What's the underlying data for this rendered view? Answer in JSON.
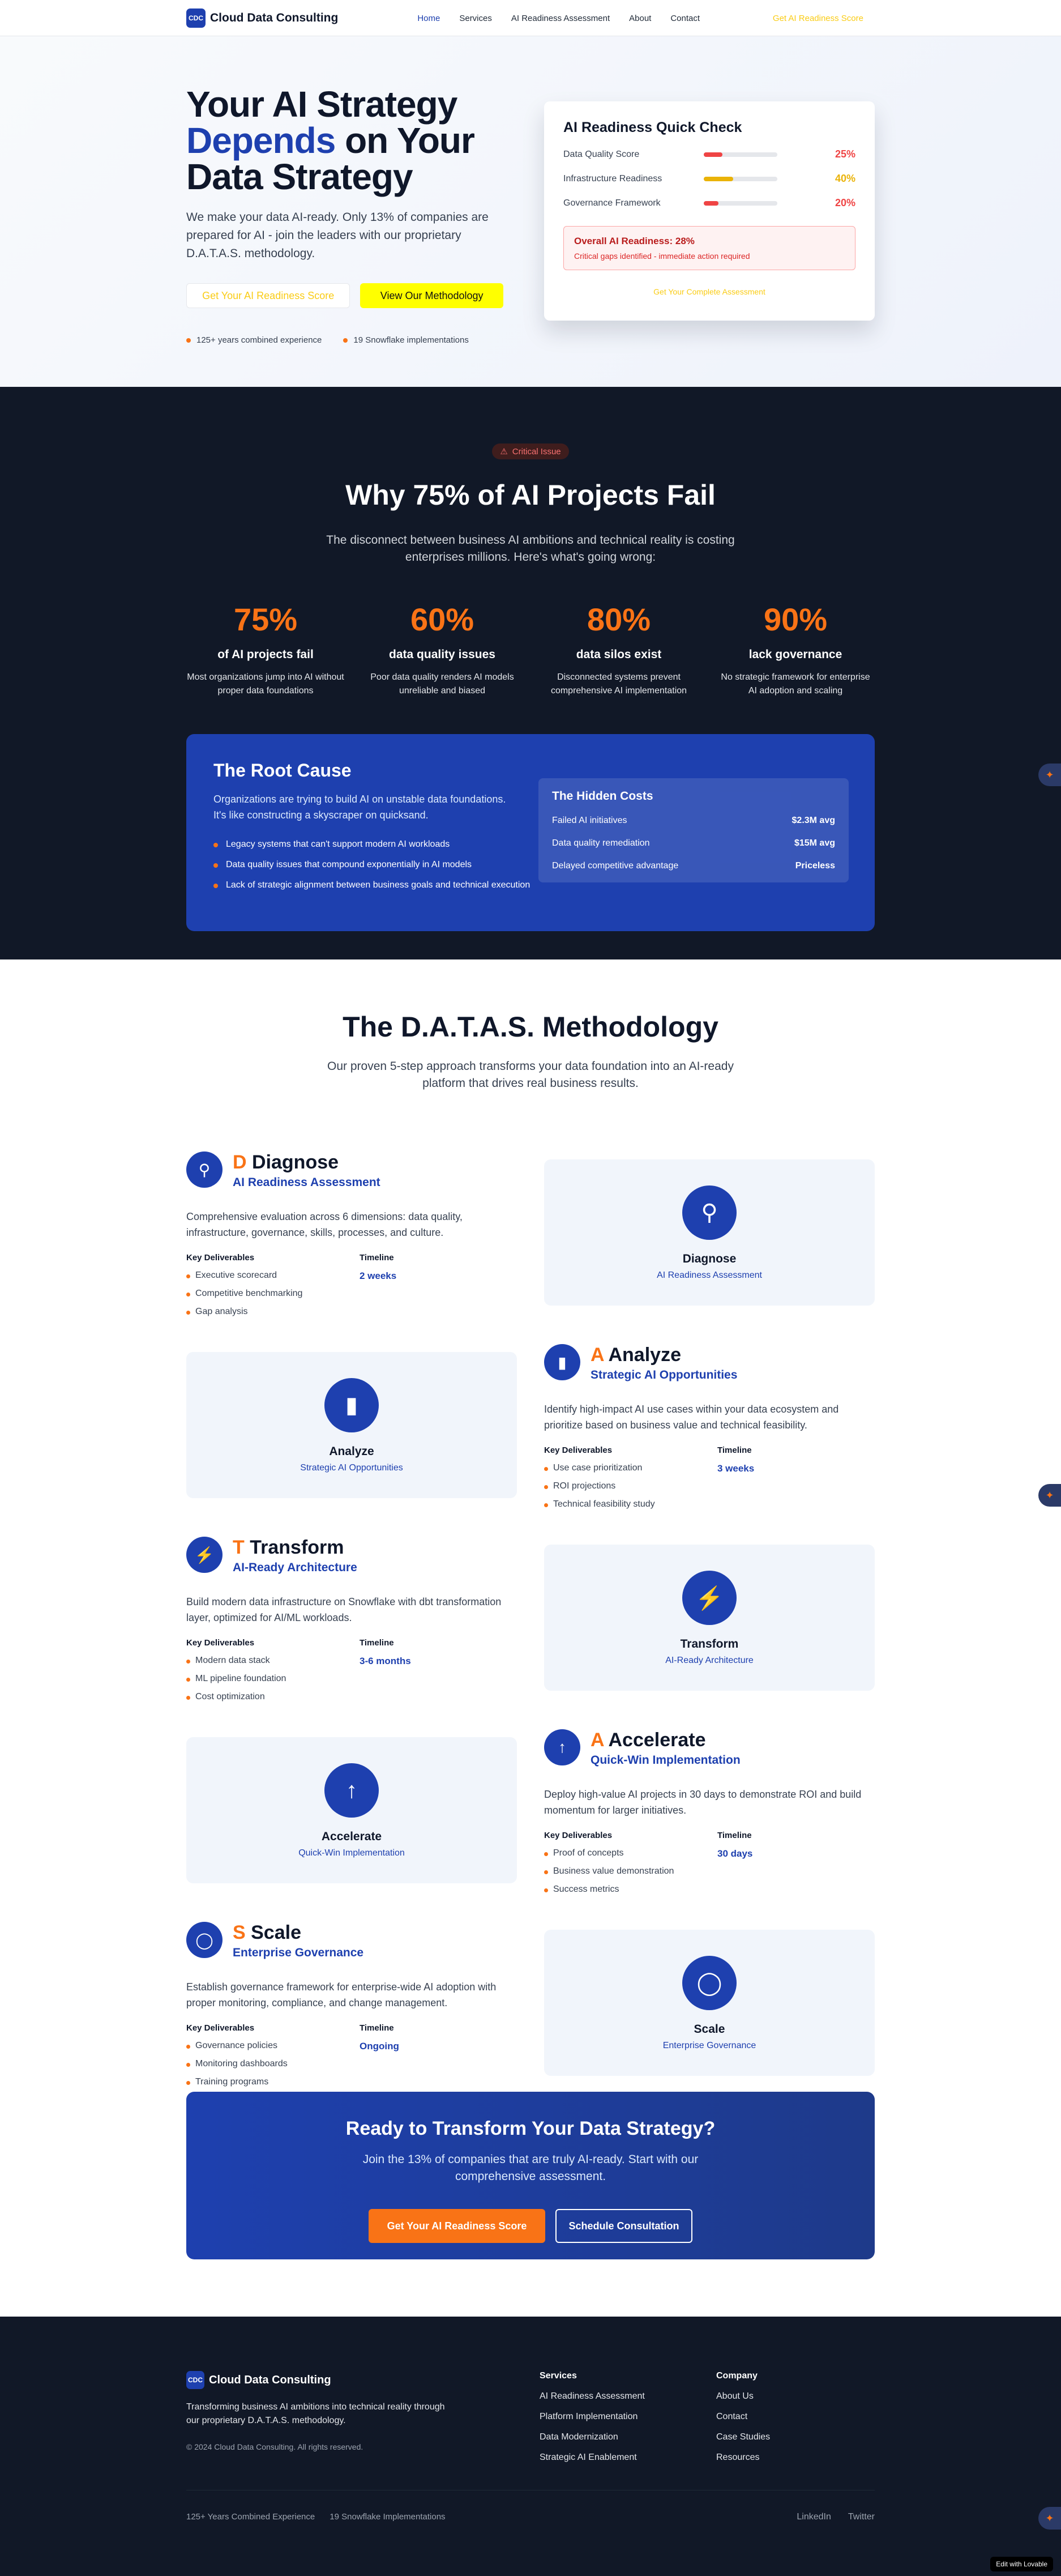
{
  "nav": {
    "brand": "Cloud Data Consulting",
    "logo_text": "CDC",
    "items": [
      "Home",
      "Services",
      "AI Readiness Assessment",
      "About",
      "Contact"
    ],
    "cta": "Get AI Readiness Score"
  },
  "hero": {
    "title_1": "Your AI Strategy",
    "title_blue": "Depends",
    "title_2": " on Your",
    "title_3": "Data Strategy",
    "description": "We make your data AI-ready. Only 13% of companies are prepared for AI - join the leaders with our proprietary D.A.T.A.S. methodology.",
    "btn_primary": "Get Your AI Readiness Score",
    "btn_secondary": "View Our Methodology",
    "stats": [
      "125+ years combined experience",
      "19 Snowflake implementations"
    ],
    "card": {
      "title": "AI Readiness Quick Check",
      "metrics": [
        {
          "label": "Data Quality Score",
          "value": "25%",
          "fill": 0.25,
          "color": "#ef4444"
        },
        {
          "label": "Infrastructure Readiness",
          "value": "40%",
          "fill": 0.4,
          "color": "#eab308"
        },
        {
          "label": "Governance Framework",
          "value": "20%",
          "fill": 0.2,
          "color": "#ef4444"
        }
      ],
      "alert_title": "Overall AI Readiness: 28%",
      "alert_text": "Critical gaps identified - immediate action required",
      "link": "Get Your Complete Assessment"
    }
  },
  "why": {
    "pill": "Critical Issue",
    "title": "Why 75% of AI Projects Fail",
    "subtitle": "The disconnect between business AI ambitions and technical reality is costing enterprises millions. Here's what's going wrong:",
    "stats": [
      {
        "big": "75%",
        "title": "of AI projects fail",
        "desc": "Most organizations jump into AI without proper data foundations"
      },
      {
        "big": "60%",
        "title": "data quality issues",
        "desc": "Poor data quality renders AI models unreliable and biased"
      },
      {
        "big": "80%",
        "title": "data silos exist",
        "desc": "Disconnected systems prevent comprehensive AI implementation"
      },
      {
        "big": "90%",
        "title": "lack governance",
        "desc": "No strategic framework for enterprise AI adoption and scaling"
      }
    ],
    "root": {
      "title": "The Root Cause",
      "text": "Organizations are trying to build AI on unstable data foundations. It's like constructing a skyscraper on quicksand.",
      "items": [
        "Legacy systems that can't support modern AI workloads",
        "Data quality issues that compound exponentially in AI models",
        "Lack of strategic alignment between business goals and technical execution"
      ],
      "hidden_title": "The Hidden Costs",
      "costs": [
        {
          "label": "Failed AI initiatives",
          "value": "$2.3M avg"
        },
        {
          "label": "Data quality remediation",
          "value": "$15M avg"
        },
        {
          "label": "Delayed competitive advantage",
          "value": "Priceless"
        }
      ]
    }
  },
  "method": {
    "title": "The D.A.T.A.S. Methodology",
    "subtitle": "Our proven 5-step approach transforms your data foundation into an AI-ready platform that drives real business results.",
    "deliverables_label": "Key Deliverables",
    "timeline_label": "Timeline",
    "steps": [
      {
        "letter": "D",
        "name": " Diagnose",
        "vis_name": "Diagnose",
        "sub": "AI Readiness Assessment",
        "icon": "search-icon",
        "desc": "Comprehensive evaluation across 6 dimensions: data quality, infrastructure, governance, skills, processes, and culture.",
        "items": [
          "Executive scorecard",
          "Competitive benchmarking",
          "Gap analysis"
        ],
        "timeline": "2 weeks"
      },
      {
        "letter": "A",
        "name": " Analyze",
        "vis_name": "Analyze",
        "sub": "Strategic AI Opportunities",
        "icon": "bar-chart-icon",
        "desc": "Identify high-impact AI use cases within your data ecosystem and prioritize based on business value and technical feasibility.",
        "items": [
          "Use case prioritization",
          "ROI projections",
          "Technical feasibility study"
        ],
        "timeline": "3 weeks"
      },
      {
        "letter": "T",
        "name": " Transform",
        "vis_name": "Transform",
        "sub": "AI-Ready Architecture",
        "icon": "lightning-icon",
        "desc": "Build modern data infrastructure on Snowflake with dbt transformation layer, optimized for AI/ML workloads.",
        "items": [
          "Modern data stack",
          "ML pipeline foundation",
          "Cost optimization"
        ],
        "timeline": "3-6 months"
      },
      {
        "letter": "A",
        "name": " Accelerate",
        "vis_name": "Accelerate",
        "sub": "Quick-Win Implementation",
        "icon": "arrow-up-icon",
        "desc": "Deploy high-value AI projects in 30 days to demonstrate ROI and build momentum for larger initiatives.",
        "items": [
          "Proof of concepts",
          "Business value demonstration",
          "Success metrics"
        ],
        "timeline": "30 days"
      },
      {
        "letter": "S",
        "name": " Scale",
        "vis_name": "Scale",
        "sub": "Enterprise Governance",
        "icon": "shield-icon",
        "desc": "Establish governance framework for enterprise-wide AI adoption with proper monitoring, compliance, and change management.",
        "items": [
          "Governance policies",
          "Monitoring dashboards",
          "Training programs"
        ],
        "timeline": "Ongoing"
      }
    ],
    "cta": {
      "title": "Ready to Transform Your Data Strategy?",
      "text": "Join the 13% of companies that are truly AI-ready. Start with our comprehensive assessment.",
      "primary": "Get Your AI Readiness Score",
      "secondary": "Schedule Consultation"
    }
  },
  "footer": {
    "brand": "Cloud Data Consulting",
    "logo_text": "CDC",
    "desc": "Transforming business AI ambitions into technical reality through our proprietary D.A.T.A.S. methodology.",
    "copyright": "© 2024 Cloud Data Consulting. All rights reserved.",
    "services_title": "Services",
    "services": [
      "AI Readiness Assessment",
      "Platform Implementation",
      "Data Modernization",
      "Strategic AI Enablement"
    ],
    "company_title": "Company",
    "company": [
      "About Us",
      "Contact",
      "Case Studies",
      "Resources"
    ],
    "bottom_left": [
      "125+ Years Combined Experience",
      "19 Snowflake Implementations"
    ],
    "social": [
      "LinkedIn",
      "Twitter"
    ],
    "badge": "Edit with Lovable"
  }
}
